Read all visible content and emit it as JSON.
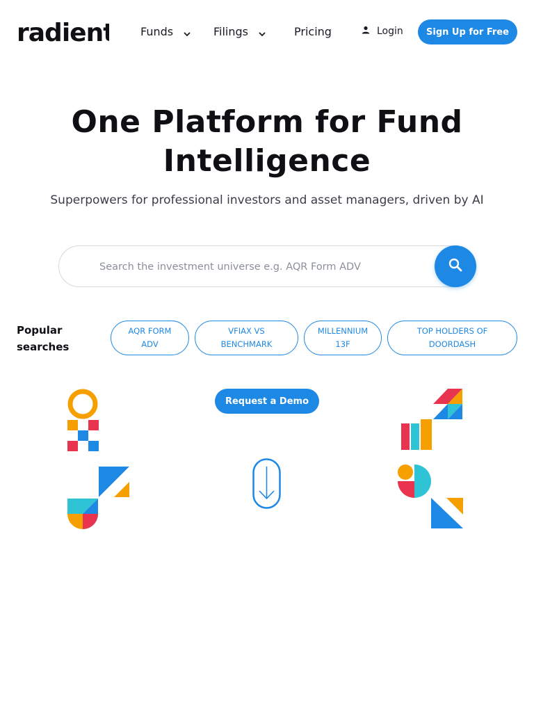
{
  "nav": {
    "logo_text": "radient",
    "items": [
      {
        "label": "Funds",
        "has_dropdown": true
      },
      {
        "label": "Filings",
        "has_dropdown": true
      },
      {
        "label": "Pricing",
        "has_dropdown": false
      }
    ],
    "login_label": "Login",
    "signup_label": "Sign Up for Free"
  },
  "hero": {
    "title_line1": "One Platform for Fund",
    "title_line2": "Intelligence",
    "subtitle": "Superpowers for professional investors and asset managers, driven by AI"
  },
  "search": {
    "placeholder": "Search the investment universe e.g. AQR Form ADV",
    "value": ""
  },
  "popular": {
    "label_line1": "Popular",
    "label_line2": "searches",
    "chips": [
      {
        "line1": "AQR FORM",
        "line2": "ADV"
      },
      {
        "line1": "VFIAX VS",
        "line2": "BENCHMARK"
      },
      {
        "line1": "MILLENNIUM",
        "line2": "13F"
      },
      {
        "line1": "TOP HOLDERS OF",
        "line2": "DOORDASH"
      }
    ]
  },
  "cta": {
    "demo_label": "Request a Demo"
  },
  "colors": {
    "accent": "#1e88e5",
    "orange": "#f5a000",
    "red": "#e8344e",
    "teal": "#2ec4d6",
    "dark": "#101014"
  },
  "icons": [
    "user-icon",
    "search-icon",
    "chevron-down-icon",
    "arrow-down-icon"
  ]
}
